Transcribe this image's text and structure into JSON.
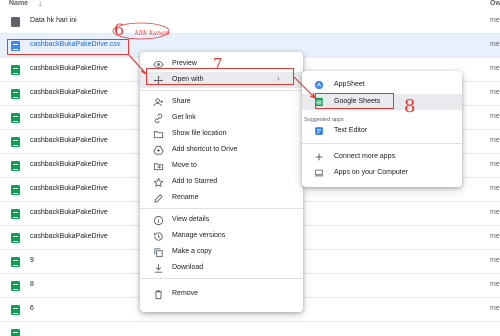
{
  "header": {
    "name_label": "Name",
    "sort_arrow": "↓",
    "owner_label": "Ow"
  },
  "files": [
    {
      "name": "Data hk hari ini",
      "type": "doc-gray",
      "owner": "me"
    },
    {
      "name": "cashbackBukaPakeDrive.csv",
      "type": "doc",
      "owner": "me"
    },
    {
      "name": "cashbackBukaPakeDrive",
      "type": "sheet",
      "owner": "me"
    },
    {
      "name": "cashbackBukaPakeDrive",
      "type": "sheet",
      "owner": "me"
    },
    {
      "name": "cashbackBukaPakeDrive",
      "type": "sheet",
      "owner": "me"
    },
    {
      "name": "cashbackBukaPakeDrive",
      "type": "sheet",
      "owner": "me"
    },
    {
      "name": "cashbackBukaPakeDrive",
      "type": "sheet",
      "owner": "me"
    },
    {
      "name": "cashbackBukaPakeDrive",
      "type": "sheet",
      "owner": "me"
    },
    {
      "name": "cashbackBukaPakeDrive",
      "type": "sheet",
      "owner": "me"
    },
    {
      "name": "cashbackBukaPakeDrive",
      "type": "sheet",
      "owner": "me"
    },
    {
      "name": "9",
      "type": "sheet",
      "owner": "me"
    },
    {
      "name": "8",
      "type": "sheet",
      "owner": "me"
    },
    {
      "name": "6",
      "type": "sheet",
      "owner": "me"
    },
    {
      "name": "",
      "type": "sheet",
      "owner": ""
    }
  ],
  "context_menu": {
    "preview": "Preview",
    "open_with": "Open with",
    "open_with_chevron": "›",
    "share": "Share",
    "get_link": "Get link",
    "show_file_location": "Show file location",
    "add_shortcut": "Add shortcut to Drive",
    "move_to": "Move to",
    "add_starred": "Add to Starred",
    "rename": "Rename",
    "view_details": "View details",
    "manage_versions": "Manage versions",
    "make_copy": "Make a copy",
    "download": "Download",
    "remove": "Remove"
  },
  "submenu": {
    "appsheet": "AppSheet",
    "google_sheets": "Google Sheets",
    "suggested_heading": "Suggested apps",
    "text_editor": "Text Editor",
    "connect_more_apps": "Connect more apps",
    "apps_on_computer": "Apps on your Computer"
  },
  "annotations": {
    "step6": "6",
    "klik_kanan": "klik kanan",
    "step7": "7",
    "step8": "8"
  },
  "colors": {
    "annotation": "#e53935",
    "sheet_icon": "#0f9d58",
    "doc_icon": "#4285f4",
    "selected_row": "#e8f0fe"
  }
}
